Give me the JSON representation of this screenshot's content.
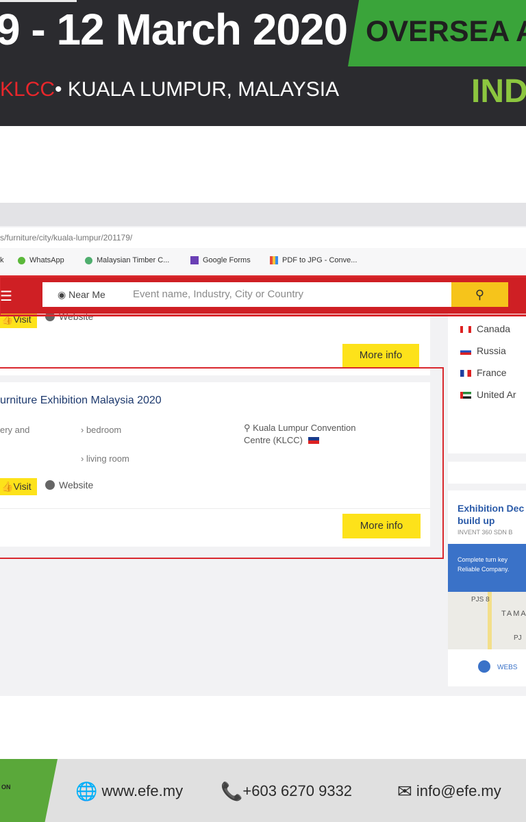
{
  "banner": {
    "dates": "9 - 12 March 2020",
    "venue": "KLCC",
    "city": "• KUALA LUMPUR, MALAYSIA",
    "tag": "OVERSEA A",
    "tag2": "IND"
  },
  "browser": {
    "address": "s/furniture/city/kuala-lumpur/201179/",
    "bookmarks": [
      {
        "label": "k",
        "icon": "bookmark-icon"
      },
      {
        "label": "WhatsApp",
        "icon": "whatsapp-icon"
      },
      {
        "label": "Malaysian Timber C...",
        "icon": "timber-icon"
      },
      {
        "label": "Google Forms",
        "icon": "forms-icon"
      },
      {
        "label": "PDF to JPG - Conve...",
        "icon": "pdf-icon"
      }
    ]
  },
  "search": {
    "near_me": "Near Me",
    "placeholder": "Event name, Industry, City or Country"
  },
  "listing_prev": {
    "visit": "Visit",
    "website": "Website",
    "more_info": "More info"
  },
  "listing": {
    "title": "urniture Exhibition Malaysia 2020",
    "category_left": "ery and",
    "tags": [
      "bedroom",
      "living room"
    ],
    "venue": "Kuala Lumpur Convention Centre (KLCC)",
    "visit": "Visit",
    "website": "Website",
    "more_info": "More info"
  },
  "countries": [
    "Canada",
    "Russia",
    "France",
    "United Ar"
  ],
  "ad": {
    "title": "Exhibition Dec",
    "title2": "build up",
    "company": "INVENT 360 SDN B",
    "banner_line1": "Complete turn key",
    "banner_line2": "Reliable Company.",
    "map_label1": "PJS 8",
    "map_label2": "TAMA",
    "map_label3": "PJ",
    "website": "WEBS"
  },
  "contacts": {
    "logo_text": "ON",
    "web": "www.efe.my",
    "phone": "+603 6270 9332",
    "email": "info@efe.my"
  },
  "colors": {
    "banner_bg": "#2b2b2f",
    "nav_red": "#cf1f24",
    "accent_yellow": "#fde21a",
    "green": "#3aa43a"
  }
}
